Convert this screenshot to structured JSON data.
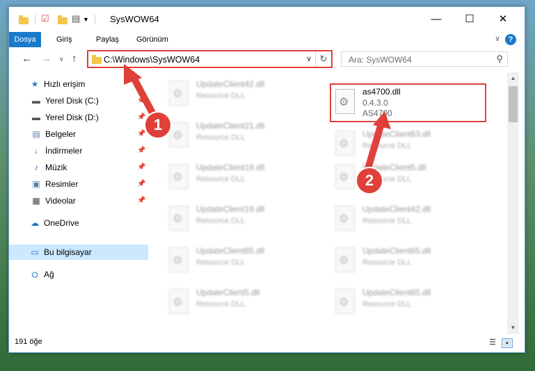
{
  "window": {
    "title": "SysWOW64"
  },
  "ribbon": {
    "tabs": [
      "Dosya",
      "Giriş",
      "Paylaş",
      "Görünüm"
    ]
  },
  "address": {
    "path": "C:\\Windows\\SysWOW64"
  },
  "search": {
    "placeholder": "Ara: SysWOW64"
  },
  "sidebar": {
    "quick_access": "Hızlı erişim",
    "items": [
      {
        "label": "Yerel Disk (C:)",
        "icon": "drive-icon"
      },
      {
        "label": "Yerel Disk (D:)",
        "icon": "drive-icon"
      },
      {
        "label": "Belgeler",
        "icon": "documents-icon"
      },
      {
        "label": "İndirmeler",
        "icon": "downloads-icon"
      },
      {
        "label": "Müzik",
        "icon": "music-icon"
      },
      {
        "label": "Resimler",
        "icon": "pictures-icon"
      },
      {
        "label": "Videolar",
        "icon": "videos-icon"
      }
    ],
    "onedrive": "OneDrive",
    "this_pc": "Bu bilgisayar",
    "network": "Ağ"
  },
  "files": {
    "highlighted": {
      "name": "as4700.dll",
      "version": "0.4.3.0",
      "description": "AS4700"
    },
    "left_column": [
      {
        "name": "UpdateClient42.dll",
        "type": "Resource DLL"
      },
      {
        "name": "UpdateClient21.dll",
        "type": "Resource DLL"
      },
      {
        "name": "UpdateClient19.dll",
        "type": "Resource DLL"
      },
      {
        "name": "UpdateClient19.dll",
        "type": "Resource DLL"
      },
      {
        "name": "UpdateClient65.dll",
        "type": "Resource DLL"
      },
      {
        "name": "UpdateClient5.dll",
        "type": "Resource DLL"
      }
    ],
    "right_column": [
      {
        "name": "UpdateClient63.dll",
        "type": "Resource DLL"
      },
      {
        "name": "UpdateClient5.dll",
        "type": "Resource DLL"
      },
      {
        "name": "UpdateClient42.dll",
        "type": "Resource DLL"
      },
      {
        "name": "UpdateClient65.dll",
        "type": "Resource DLL"
      },
      {
        "name": "UpdateClient65.dll",
        "type": "Resource DLL"
      }
    ]
  },
  "status": {
    "item_count": "191 öğe"
  },
  "annotations": {
    "step1": "1",
    "step2": "2",
    "color": "#e0403a"
  }
}
